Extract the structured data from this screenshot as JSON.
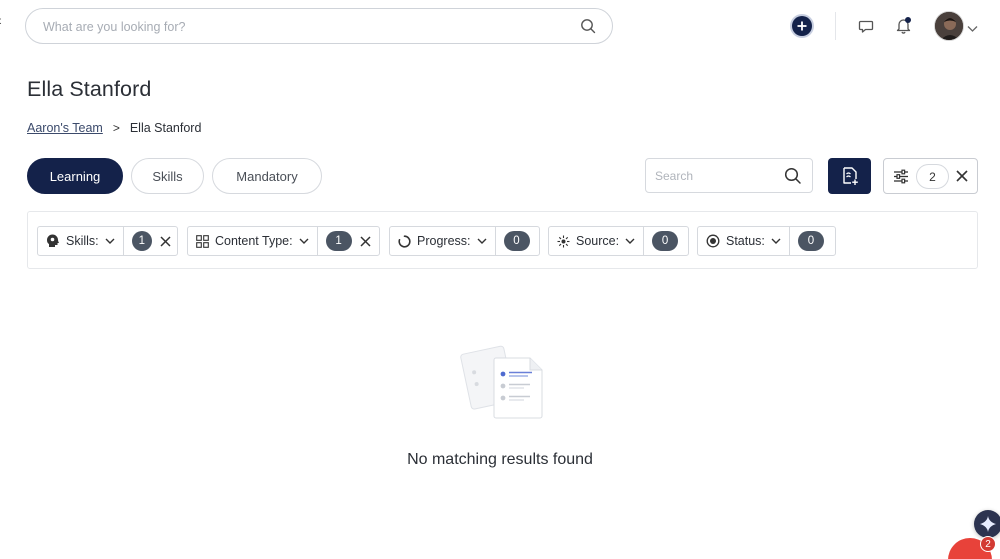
{
  "topbar": {
    "search_placeholder": "What are you looking for?",
    "icons": [
      "back-caret-icon",
      "search-icon",
      "add-circle-icon",
      "chat-icon",
      "bell-icon",
      "avatar",
      "chevron-down-icon"
    ]
  },
  "header": {
    "title": "Ella Stanford",
    "breadcrumb": {
      "parent": "Aaron's Team",
      "separator": ">",
      "current": "Ella Stanford"
    }
  },
  "tabs": [
    {
      "label": "Learning",
      "active": true
    },
    {
      "label": "Skills",
      "active": false
    },
    {
      "label": "Mandatory",
      "active": false
    }
  ],
  "toolbar": {
    "search_placeholder": "Search",
    "active_filter_count": "2"
  },
  "filters": [
    {
      "label": "Skills:",
      "count": "1",
      "clearable": true,
      "icon": "head-icon"
    },
    {
      "label": "Content Type:",
      "count": "1",
      "clearable": true,
      "icon": "grid-icon"
    },
    {
      "label": "Progress:",
      "count": "0",
      "clearable": false,
      "icon": "progress-icon"
    },
    {
      "label": "Source:",
      "count": "0",
      "clearable": false,
      "icon": "sparkle-icon"
    },
    {
      "label": "Status:",
      "count": "0",
      "clearable": false,
      "icon": "target-icon"
    }
  ],
  "empty_state": {
    "message": "No matching results found"
  },
  "widgets": {
    "chat_badge": "2"
  },
  "colors": {
    "primary": "#14224a",
    "badge": "#4b5563",
    "chat": "#e8423a",
    "border": "#d6d9de"
  }
}
